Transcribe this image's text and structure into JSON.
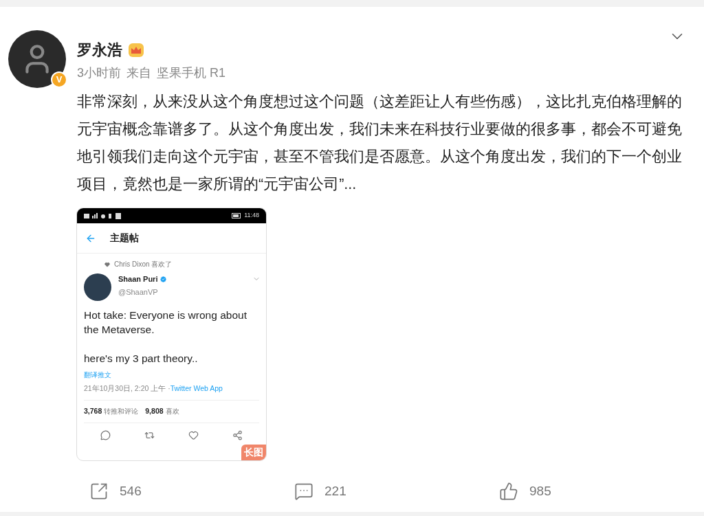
{
  "post": {
    "author": "罗永浩",
    "verified_badge": "V",
    "time": "3小时前",
    "source_label": "来自",
    "source": "坚果手机 R1",
    "text": "非常深刻，从来没从这个角度想过这个问题（这差距让人有些伤感），这比扎克伯格理解的元宇宙概念靠谱多了。从这个角度出发，我们未来在科技行业要做的很多事，都会不可避免地引领我们走向这个元宇宙，甚至不管我们是否愿意。从这个角度出发，我们的下一个创业项目，竟然也是一家所谓的“元宇宙公司”...",
    "image": {
      "status_time": "11:48",
      "header_title": "主题帖",
      "liked_by": "Chris Dixon 喜欢了",
      "user_name": "Shaan Puri",
      "handle": "@ShaanVP",
      "tweet_lines": [
        "Hot take: Everyone is wrong about the Metaverse.",
        "here's my 3 part theory.."
      ],
      "translate": "翻译推文",
      "timestamp": "21年10月30日, 2:20 上午 · ",
      "client": "Twitter Web App",
      "stats": [
        {
          "count": "3,768",
          "label": "转推和评论"
        },
        {
          "count": "9,808",
          "label": "喜欢"
        }
      ],
      "long_image_badge": "长图"
    }
  },
  "actions": [
    {
      "kind": "share",
      "count": "546"
    },
    {
      "kind": "comment",
      "count": "221"
    },
    {
      "kind": "like",
      "count": "985"
    }
  ]
}
